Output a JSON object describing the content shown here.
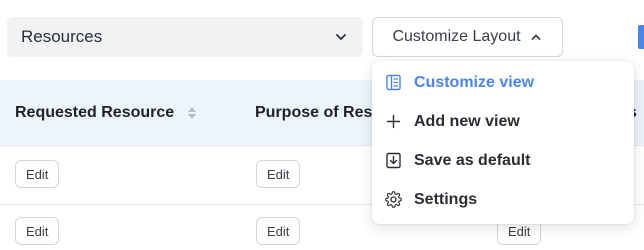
{
  "resource_select": {
    "value": "Resources",
    "icon": "chevron-down-icon"
  },
  "customize_button": {
    "label": "Customize Layout",
    "icon": "chevron-up-icon"
  },
  "table": {
    "headers": [
      {
        "label": "Requested Resource",
        "sortable": true
      },
      {
        "label": "Purpose of Res"
      },
      {
        "label": "s"
      }
    ],
    "rows": [
      {
        "col1": "Edit",
        "col2": "Edit"
      },
      {
        "col1": "Edit",
        "col2": "Edit",
        "col3": "Edit"
      }
    ]
  },
  "menu": {
    "items": [
      {
        "label": "Customize view",
        "icon": "customize-view-icon",
        "active": true
      },
      {
        "label": "Add new view",
        "icon": "plus-icon",
        "active": false
      },
      {
        "label": "Save as default",
        "icon": "save-download-icon",
        "active": false
      },
      {
        "label": "Settings",
        "icon": "gear-icon",
        "active": false
      }
    ]
  },
  "colors": {
    "accent": "#4a86e8",
    "header_bg": "#eef4fd",
    "select_bg": "#f1f2f4"
  }
}
